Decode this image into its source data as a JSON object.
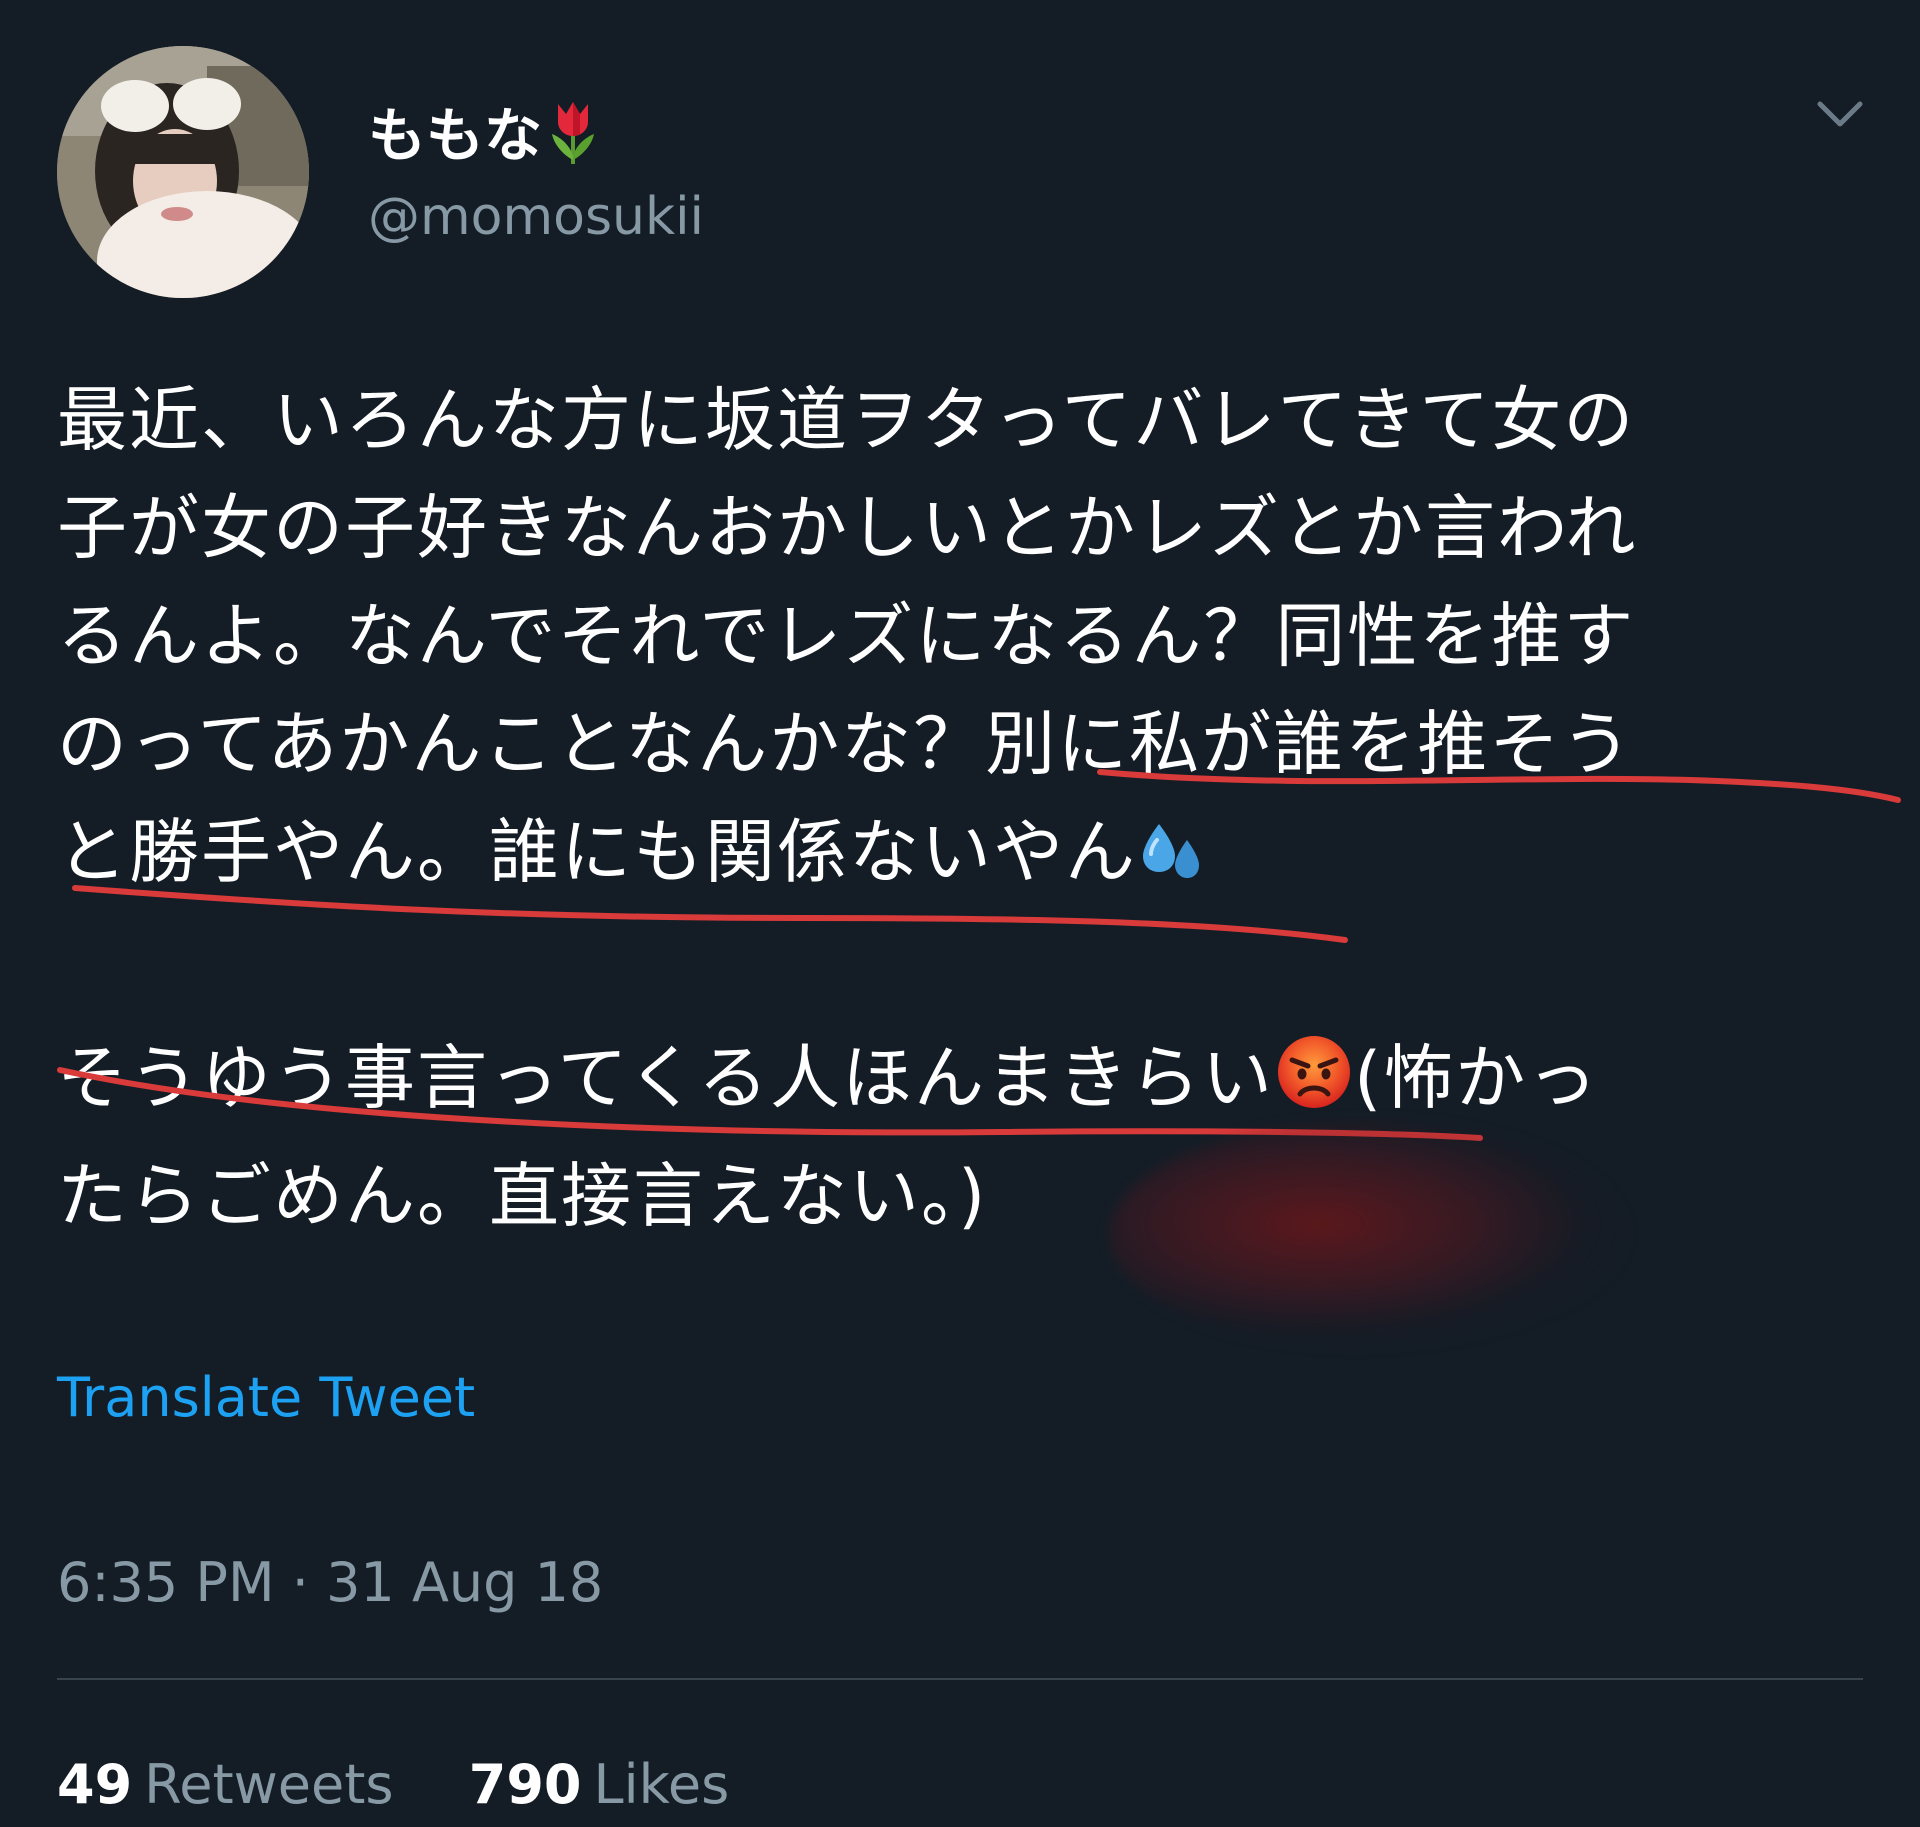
{
  "tweet": {
    "display_name": "ももな",
    "display_name_emoji": "tulip-emoji",
    "handle": "@momosukii",
    "body_lines": [
      "最近、いろんな方に坂道ヲタってバレてきて女の",
      "子が女の子好きなんおかしいとかレズとか言われ",
      "るんよ。なんでそれでレズになるん？同性を推す",
      "のってあかんことなんかな？別に私が誰を推そう",
      "と勝手やん。誰にも関係ないやん"
    ],
    "body_line5_emoji": "sweat-droplets-emoji",
    "body_line7_part1": "そうゆう事言ってくる人ほんまきらい",
    "body_line7_emoji": "angry-face-emoji",
    "body_line7_part2": "(怖かっ",
    "body_line8": "たらごめん。直接言えない。)",
    "translate_label": "Translate Tweet",
    "timestamp": "6:35 PM · 31 Aug 18",
    "retweets_count": "49",
    "retweets_label": "Retweets",
    "likes_count": "790",
    "likes_label": "Likes"
  },
  "colors": {
    "background": "#141d26",
    "text": "#ffffff",
    "secondary_text": "#8899a6",
    "link": "#1da1f2",
    "annotation_underline": "#d93a3a"
  }
}
